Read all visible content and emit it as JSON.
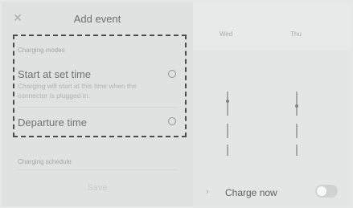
{
  "header": {
    "close_icon": "close-icon",
    "title": "Add event"
  },
  "charging_modes": {
    "label": "Charging modes",
    "options": [
      {
        "title": "Start at set time",
        "description": "Charging will start at this time when the connector is plugged in.",
        "selected": false
      },
      {
        "title": "Departure time",
        "selected": false
      }
    ]
  },
  "schedule": {
    "label": "Charging schedule"
  },
  "footer": {
    "save_label": "Save"
  },
  "calendar": {
    "days": [
      "Wed",
      "Thu"
    ]
  },
  "charge_now": {
    "label": "Charge now",
    "toggle_on": false
  }
}
